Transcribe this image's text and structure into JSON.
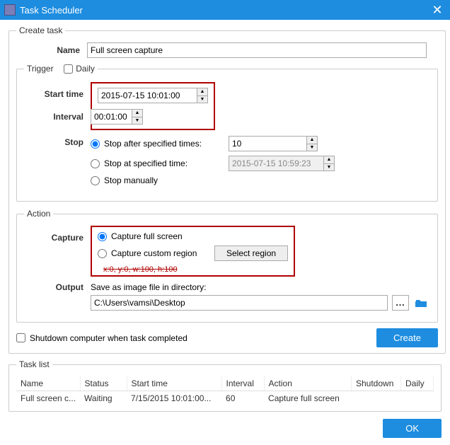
{
  "titlebar": {
    "title": "Task Scheduler"
  },
  "create_task": {
    "legend": "Create task",
    "name_label": "Name",
    "name_value": "Full screen capture",
    "trigger": {
      "legend": "Trigger",
      "daily_label": "Daily",
      "daily_checked": false,
      "start_time_label": "Start time",
      "start_time_value": "2015-07-15 10:01:00",
      "interval_label": "Interval",
      "interval_value": "00:01:00",
      "stop_label": "Stop",
      "stop_option": "after_times",
      "stop_after_times_label": "Stop after specified times:",
      "stop_after_times_value": "10",
      "stop_at_time_label": "Stop at specified time:",
      "stop_at_time_value": "2015-07-15 10:59:23",
      "stop_manually_label": "Stop manually"
    },
    "action": {
      "legend": "Action",
      "capture_label": "Capture",
      "capture_option": "full",
      "capture_full_label": "Capture full screen",
      "capture_custom_label": "Capture custom region",
      "select_region_btn": "Select region",
      "region_note": "x:0, y:0, w:100, h:100",
      "output_label": "Output",
      "output_desc": "Save as image file in directory:",
      "output_path": "C:\\Users\\vamsi\\Desktop"
    },
    "shutdown_label": "Shutdown computer when task completed",
    "shutdown_checked": false,
    "create_btn": "Create"
  },
  "task_list": {
    "legend": "Task list",
    "columns": [
      "Name",
      "Status",
      "Start time",
      "Interval",
      "Action",
      "Shutdown",
      "Daily"
    ],
    "rows": [
      {
        "name": "Full screen c...",
        "status": "Waiting",
        "start_time": "7/15/2015 10:01:00...",
        "interval": "60",
        "action": "Capture full screen",
        "shutdown": "",
        "daily": ""
      }
    ]
  },
  "footer": {
    "ok_btn": "OK"
  }
}
